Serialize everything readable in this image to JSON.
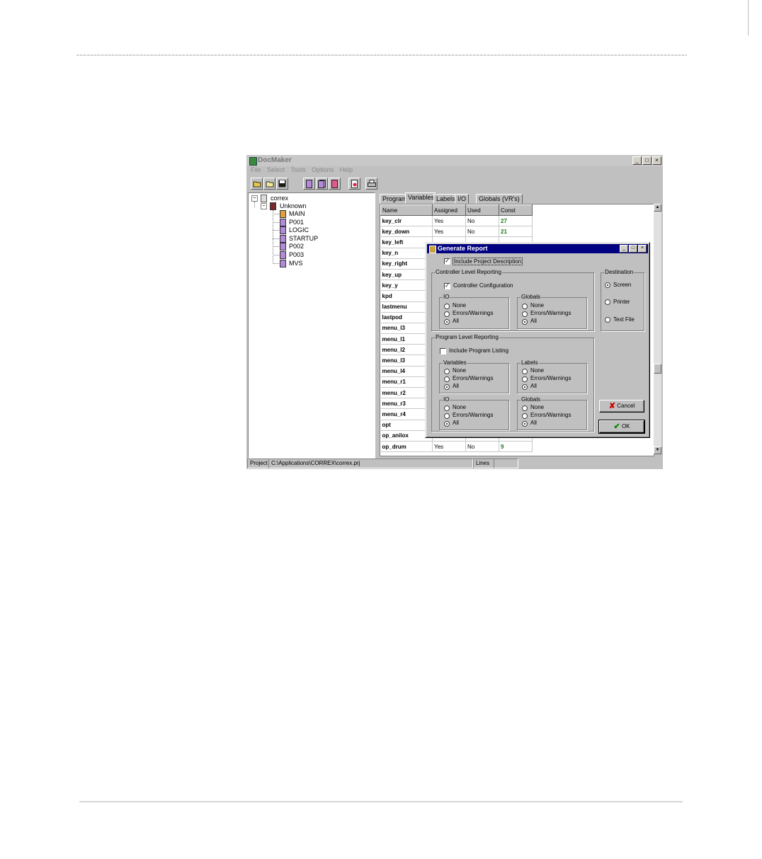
{
  "app": {
    "title": "DocMaker",
    "menu": [
      "File",
      "Select",
      "Tools",
      "Options",
      "Help"
    ],
    "window_buttons": [
      "_",
      "□",
      "×"
    ]
  },
  "tree": {
    "root": "correx",
    "child": "Unknown",
    "programs": [
      "MAIN",
      "P001",
      "LOGIC",
      "STARTUP",
      "P002",
      "P003",
      "MVS"
    ]
  },
  "tabs": [
    "Program",
    "Variables",
    "Labels",
    "I/O",
    "Globals (VR's)"
  ],
  "table": {
    "headers": [
      "Name",
      "Assigned",
      "Used",
      "Const"
    ],
    "rows": [
      {
        "name": "key_clr",
        "assigned": "Yes",
        "used": "No",
        "const": "27"
      },
      {
        "name": "key_down",
        "assigned": "Yes",
        "used": "No",
        "const": "21"
      },
      {
        "name": "key_left",
        "assigned": "",
        "used": "",
        "const": ""
      },
      {
        "name": "key_n",
        "assigned": "",
        "used": "",
        "const": ""
      },
      {
        "name": "key_right",
        "assigned": "",
        "used": "",
        "const": ""
      },
      {
        "name": "key_up",
        "assigned": "",
        "used": "",
        "const": ""
      },
      {
        "name": "key_y",
        "assigned": "",
        "used": "",
        "const": ""
      },
      {
        "name": "kpd",
        "assigned": "",
        "used": "",
        "const": ""
      },
      {
        "name": "lastmenu",
        "assigned": "",
        "used": "",
        "const": ""
      },
      {
        "name": "lastpod",
        "assigned": "",
        "used": "",
        "const": ""
      },
      {
        "name": "menu_l3",
        "assigned": "",
        "used": "",
        "const": ""
      },
      {
        "name": "menu_l1",
        "assigned": "",
        "used": "",
        "const": ""
      },
      {
        "name": "menu_l2",
        "assigned": "",
        "used": "",
        "const": ""
      },
      {
        "name": "menu_l3",
        "assigned": "",
        "used": "",
        "const": ""
      },
      {
        "name": "menu_l4",
        "assigned": "",
        "used": "",
        "const": ""
      },
      {
        "name": "menu_r1",
        "assigned": "",
        "used": "",
        "const": ""
      },
      {
        "name": "menu_r2",
        "assigned": "",
        "used": "",
        "const": ""
      },
      {
        "name": "menu_r3",
        "assigned": "",
        "used": "",
        "const": ""
      },
      {
        "name": "menu_r4",
        "assigned": "",
        "used": "",
        "const": ""
      },
      {
        "name": "opt",
        "assigned": "",
        "used": "",
        "const": ""
      },
      {
        "name": "op_anilox",
        "assigned": "",
        "used": "",
        "const": ""
      },
      {
        "name": "op_drum",
        "assigned": "Yes",
        "used": "No",
        "const": "9"
      }
    ]
  },
  "status": {
    "project_label": "Project",
    "project_path": "C:\\Applications\\CORREX\\correx.prj",
    "lines_label": "Lines"
  },
  "dialog": {
    "title": "Generate Report",
    "include_project_description": "Include Project Description",
    "controller": {
      "title": "Controller Level Reporting",
      "config_label": "Controller Configuration",
      "io_title": "IO",
      "globals_title": "Globals"
    },
    "program": {
      "title": "Program Level Reporting",
      "listing_label": "Include Program Listing",
      "variables_title": "Variables",
      "labels_title": "Labels",
      "io_title": "IO",
      "globals_title": "Globals"
    },
    "options": [
      "None",
      "Errors/Warnings",
      "All"
    ],
    "destination": {
      "title": "Destination",
      "options": [
        "Screen",
        "Printer",
        "Text File"
      ],
      "selected": "Screen"
    },
    "cancel_label": "Cancel",
    "ok_label": "OK"
  }
}
